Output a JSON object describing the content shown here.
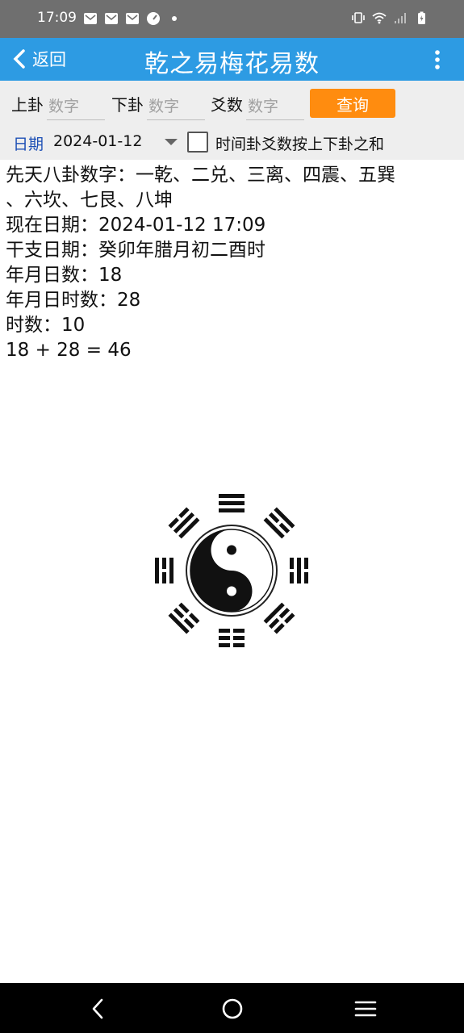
{
  "status_bar": {
    "time": "17:09",
    "left_icons": [
      "mail-icon",
      "mail-icon",
      "mail-icon",
      "speedometer-icon",
      "dot-icon"
    ],
    "right_icons": [
      "vibrate-icon",
      "wifi-icon",
      "signal-icon",
      "battery-charging-icon"
    ]
  },
  "app_bar": {
    "back_label": "返回",
    "title": "乾之易梅花易数",
    "color": "#2d9be3"
  },
  "inputs": {
    "upper_label": "上卦",
    "upper_placeholder": "数字",
    "lower_label": "下卦",
    "lower_placeholder": "数字",
    "yao_label": "爻数",
    "yao_placeholder": "数字",
    "query_label": "查询",
    "query_color": "#ff8c0f"
  },
  "date_row": {
    "label": "日期",
    "value": "2024-01-12",
    "checkbox_checked": false,
    "checkbox_label": "时间卦爻数按上下卦之和"
  },
  "result": {
    "line1": "先天八卦数字：一乾、二兑、三离、四震、五巽",
    "line2": "、六坎、七艮、八坤",
    "line3": "现在日期：2024-01-12 17:09",
    "line4": "干支日期：癸卯年腊月初二酉时",
    "line5": "年月日数：18",
    "line6": "年月日时数：28",
    "line7": "时数：10",
    "line8": "18 + 28 = 46"
  },
  "nav_bar": {
    "icons": [
      "back-nav-icon",
      "home-nav-icon",
      "recents-nav-icon"
    ]
  }
}
